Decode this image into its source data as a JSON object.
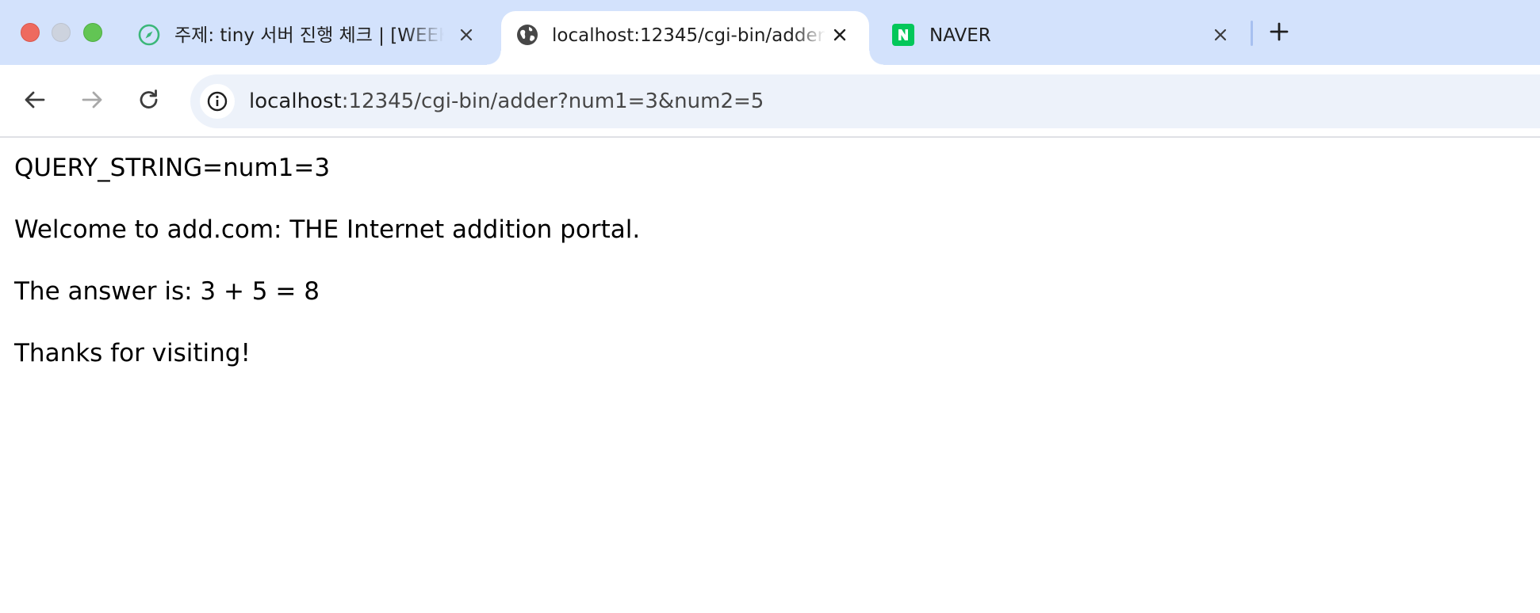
{
  "tabs": [
    {
      "title": "주제: tiny 서버 진행 체크 | [WEEK",
      "icon": "compass-icon",
      "active": false
    },
    {
      "title": "localhost:12345/cgi-bin/adder",
      "icon": "globe-icon",
      "active": true
    },
    {
      "title": "NAVER",
      "icon": "naver-n-icon",
      "active": false
    }
  ],
  "toolbar": {
    "url_host": "localhost",
    "url_path": ":12345/cgi-bin/adder?num1=3&num2=5"
  },
  "page": {
    "line1": "QUERY_STRING=num1=3",
    "line2": "Welcome to add.com: THE Internet addition portal.",
    "line3": "The answer is: 3 + 5 = 8",
    "line4": "Thanks for visiting!"
  },
  "colors": {
    "tabstrip": "#d3e2fc",
    "omnibox": "#edf2fa",
    "naver_green": "#03c75a"
  }
}
